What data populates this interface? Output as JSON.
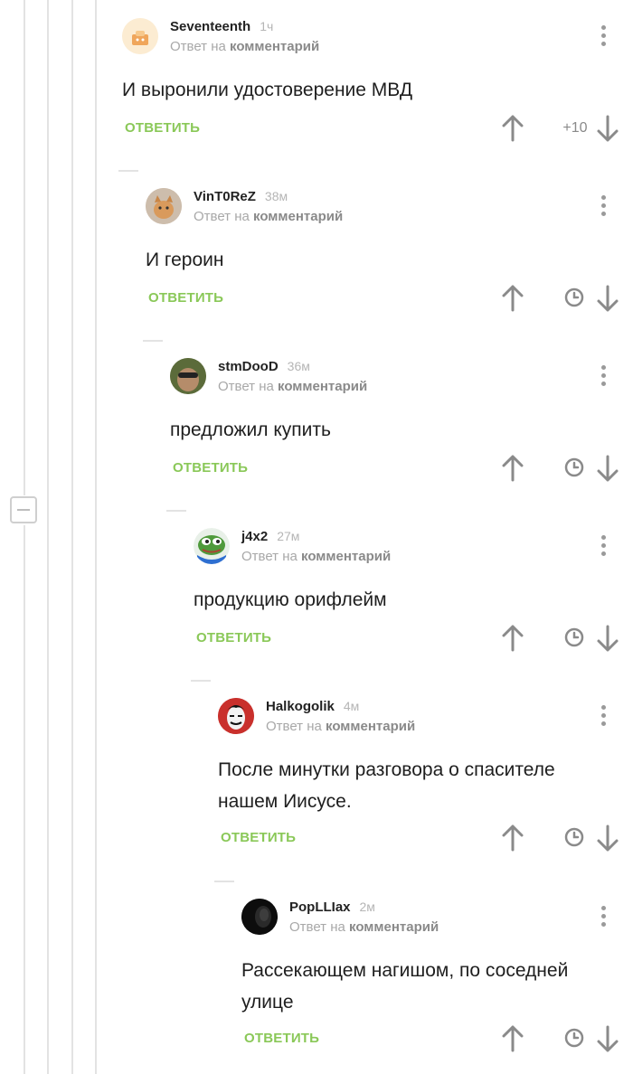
{
  "comments": [
    {
      "username": "Seventeenth",
      "time": "1ч",
      "reply_prefix": "Ответ на",
      "reply_target": "комментарий",
      "text": "И выронили удостоверение МВД",
      "reply_label": "ОТВЕТИТЬ",
      "rating": "+10"
    },
    {
      "username": "VinT0ReZ",
      "time": "38м",
      "reply_prefix": "Ответ на",
      "reply_target": "комментарий",
      "text": "И героин",
      "reply_label": "ОТВЕТИТЬ"
    },
    {
      "username": "stmDooD",
      "time": "36м",
      "reply_prefix": "Ответ на",
      "reply_target": "комментарий",
      "text": "предложил купить",
      "reply_label": "ОТВЕТИТЬ"
    },
    {
      "username": "j4x2",
      "time": "27м",
      "reply_prefix": "Ответ на",
      "reply_target": "комментарий",
      "text": "продукцию орифлейм",
      "reply_label": "ОТВЕТИТЬ"
    },
    {
      "username": "Halkogolik",
      "time": "4м",
      "reply_prefix": "Ответ на",
      "reply_target": "комментарий",
      "text": "После минутки разговора о спасителе нашем Иисусе.",
      "reply_label": "ОТВЕТИТЬ"
    },
    {
      "username": "PopLLIax",
      "time": "2м",
      "reply_prefix": "Ответ на",
      "reply_target": "комментарий",
      "text": "Рассекающем нагишом, по соседней улице",
      "reply_label": "ОТВЕТИТЬ"
    }
  ],
  "icons": {
    "upvote": "arrow-up-icon",
    "downvote": "arrow-down-icon",
    "pending": "clock-icon",
    "menu": "kebab-menu-icon",
    "collapse": "collapse-minus-icon"
  },
  "colors": {
    "reply": "#8ac858",
    "muted": "#a8a8a8",
    "thread_line": "#e3e3e3"
  }
}
